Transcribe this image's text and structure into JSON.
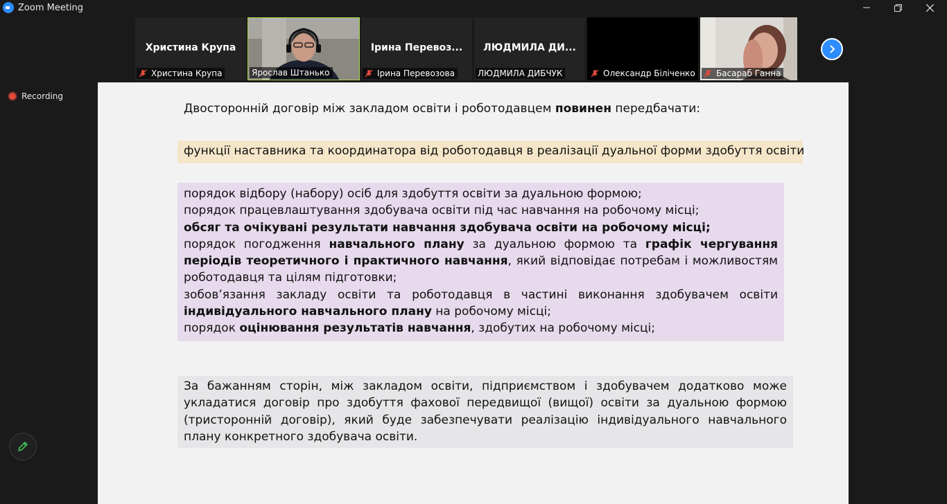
{
  "window": {
    "title": "Zoom Meeting",
    "controls": [
      "minimize",
      "restore",
      "close"
    ]
  },
  "colors": {
    "zoom_blue": "#2d8cff",
    "active_speaker_border": "#a6d64a",
    "recording_red": "#e24b3b",
    "mute_red": "#e04a3c",
    "yellow_box": "#f5e6c9",
    "purple_box": "#e6daec",
    "gray_box": "#e6e6e8"
  },
  "gallery": {
    "participants": [
      {
        "name": "Христина Крупа",
        "display": "Христина Крупа",
        "muted": true,
        "video": false
      },
      {
        "name": "Ярослав Штанько",
        "display": "",
        "muted": false,
        "video": true,
        "active": true
      },
      {
        "name": "Ірина Перевозова",
        "display": "Ірина  Перевоз...",
        "muted": true,
        "video": false
      },
      {
        "name": "ЛЮДМИЛА ДИБЧУК",
        "display": "ЛЮДМИЛА  ДИ...",
        "muted": false,
        "video": false
      },
      {
        "name": "Олександр Біліченко",
        "display": "",
        "muted": true,
        "video": "black"
      },
      {
        "name": "Басараб Ганна",
        "display": "",
        "muted": true,
        "video": true
      }
    ],
    "next_icon": "chevron-right-icon"
  },
  "recording": {
    "label": "Recording"
  },
  "annotate": {
    "icon": "pencil-icon"
  },
  "slide": {
    "heading_pre": "Двосторонній договір між закладом освіти і роботодавцем ",
    "heading_bold": "повинен",
    "heading_post": " передбачати:",
    "yellow_box": "функції наставника та координатора від роботодавця в реалізації дуальної форми здобуття освіти",
    "purple": {
      "line1": "порядок відбору (набору) осіб для здобуття освіти за дуальною формою;",
      "line2": "порядок працевлаштування здобувача освіти під час навчання на робочому місці;",
      "line3_bold": "обсяг та очікувані результати навчання здобувача освіти на робочому місці;",
      "line4_a": "порядок погодження ",
      "line4_b": "навчального плану",
      "line4_c": " за дуальною формою та ",
      "line4_d": "графік чергування періодів теоретичного і практичного навчання",
      "line4_e": ", який відповідає потребам і можливостям роботодавця та цілям підготовки;",
      "line5_a": "зобов’язання закладу освіти та роботодавця в частині виконання здобувачем освіти ",
      "line5_b": "індивідуального навчального плану",
      "line5_c": " на робочому місці;",
      "line6_a": "порядок ",
      "line6_b": "оцінювання результатів навчання",
      "line6_c": ", здобутих на робочому місці;"
    },
    "gray_box": "За бажанням сторін, між закладом освіти, підприємством і здобувачем додатково може укладатися договір про здобуття фахової передвищої (вищої) освіти за дуальною формою (тристоронній договір), який буде забезпечувати реалізацію індивідуального навчального плану конкретного здобувача освіти."
  }
}
